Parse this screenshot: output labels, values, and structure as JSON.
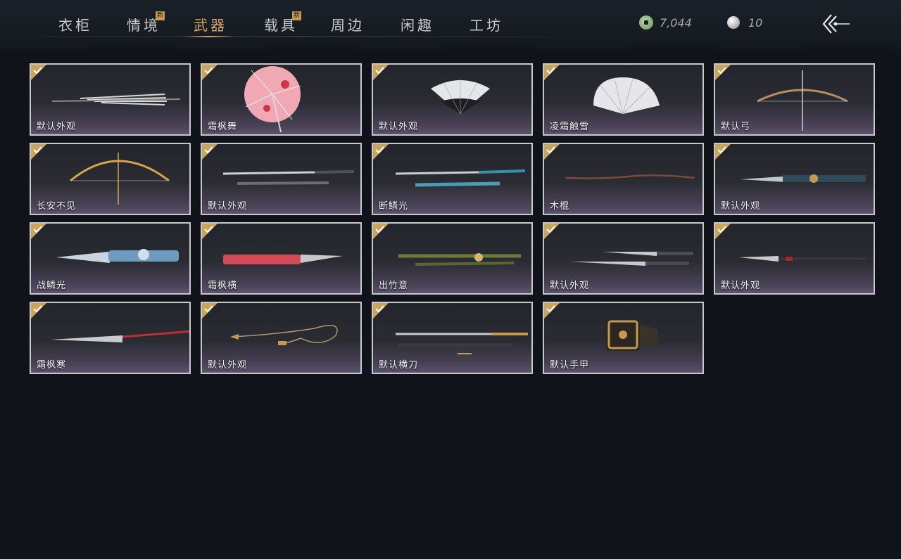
{
  "tabs": [
    {
      "label": "衣柜",
      "badge": ""
    },
    {
      "label": "情境",
      "badge": "新"
    },
    {
      "label": "武器",
      "badge": ""
    },
    {
      "label": "载具",
      "badge": "新"
    },
    {
      "label": "周边",
      "badge": ""
    },
    {
      "label": "闲趣",
      "badge": ""
    },
    {
      "label": "工坊",
      "badge": ""
    }
  ],
  "active_tab": "武器",
  "currency": {
    "jade": {
      "icon": "jade-coin-icon",
      "value": "7,044"
    },
    "pearl": {
      "icon": "pearl-icon",
      "value": "10"
    }
  },
  "back_icon": "back-arrow-icon",
  "colors": {
    "accent": "#d9a86a",
    "check": "#c9a45c",
    "background": "#10141a"
  },
  "items": [
    {
      "label": "默认外观",
      "art": "folded-umbrella",
      "owned": true
    },
    {
      "label": "霜枫舞",
      "art": "red-paper-umbrella",
      "owned": true
    },
    {
      "label": "默认外观",
      "art": "folding-fan",
      "owned": true
    },
    {
      "label": "凌霜触雪",
      "art": "white-feather-fan",
      "owned": true
    },
    {
      "label": "默认弓",
      "art": "bow",
      "owned": true
    },
    {
      "label": "长安不见",
      "art": "golden-bow",
      "owned": true
    },
    {
      "label": "默认外观",
      "art": "sword-and-scabbard",
      "owned": true
    },
    {
      "label": "断鳞光",
      "art": "jade-sword",
      "owned": true
    },
    {
      "label": "木棍",
      "art": "wooden-staff",
      "owned": true
    },
    {
      "label": "默认外观",
      "art": "ornate-blade",
      "owned": true
    },
    {
      "label": "战鳞光",
      "art": "dragon-blade",
      "owned": true
    },
    {
      "label": "霜枫横",
      "art": "red-blade",
      "owned": true
    },
    {
      "label": "出竹意",
      "art": "bamboo-sword",
      "owned": true
    },
    {
      "label": "默认外观",
      "art": "twin-blades",
      "owned": true
    },
    {
      "label": "默认外观",
      "art": "long-spear",
      "owned": true
    },
    {
      "label": "霜枫寒",
      "art": "red-spear",
      "owned": true
    },
    {
      "label": "默认外观",
      "art": "rope-dart",
      "owned": true
    },
    {
      "label": "默认横刀",
      "art": "hengdao",
      "owned": true
    },
    {
      "label": "默认手甲",
      "art": "gauntlet",
      "owned": true
    }
  ]
}
